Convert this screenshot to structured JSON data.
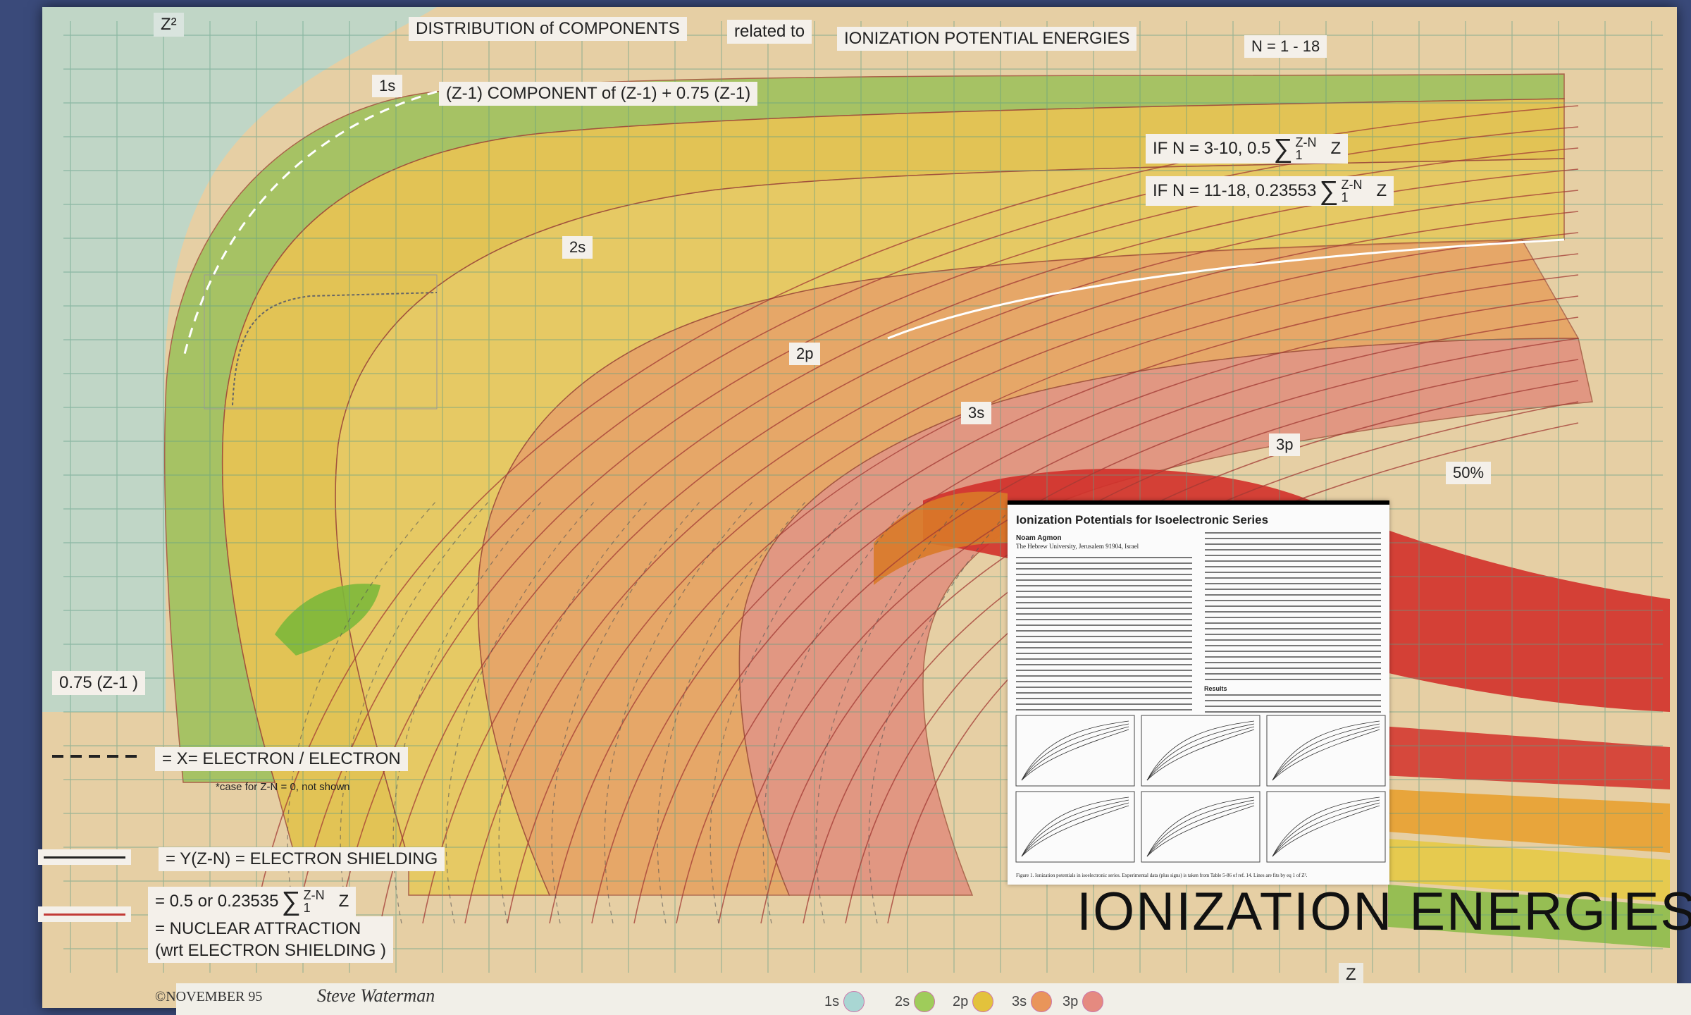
{
  "title": {
    "line": "DISTRIBUTION of COMPONENTS",
    "related": "related to",
    "topic": "IONIZATION POTENTIAL ENERGIES",
    "range": "N = 1 - 18"
  },
  "axes": {
    "y_label": "Z²",
    "x_label": "Z"
  },
  "component_label": "(Z-1)  COMPONENT of  (Z-1)  +  0.75 (Z-1)",
  "conditions": [
    {
      "prefix": "IF N = 3-10, 0.5",
      "upper": "Z-N",
      "lower": "1",
      "suffix": "Z"
    },
    {
      "prefix": "IF N = 11-18, 0.23553",
      "upper": "Z-N",
      "lower": "1",
      "suffix": "Z"
    }
  ],
  "orbital_labels": {
    "s1": "1s",
    "s2": "2s",
    "p2": "2p",
    "s3": "3s",
    "p3": "3p",
    "pct": "50%"
  },
  "left_label": "0.75 (Z-1 )",
  "legend": {
    "x_def": "= X= ELECTRON / ELECTRON",
    "x_note": "*case for Z-N = 0, not shown",
    "y_def": "= Y(Z-N) = ELECTRON SHIELDING",
    "shield_prefix": "= 0.5 or 0.23535",
    "shield_upper": "Z-N",
    "shield_lower": "1",
    "shield_suffix": "Z",
    "nuclear_1": "= NUCLEAR ATTRACTION",
    "nuclear_2": "(wrt ELECTRON SHIELDING )"
  },
  "paper": {
    "title": "Ionization Potentials for Isoelectronic Series",
    "author": "Noam Agmon",
    "affiliation": "The Hebrew University, Jerusalem 91904, Israel",
    "results_head": "Results",
    "caption": "Figure 1. Ionization potentials in isoelectronic series. Experimental data (plus signs) is taken from Table 5-86 of ref. 14. Lines are fits by eq 1 of Z²."
  },
  "big_title": "IONIZATION     ENERGIES",
  "copyright": "©NOVEMBER 95",
  "signature": "Steve Waterman",
  "footer": [
    {
      "label": "1s",
      "color": "#a9d6d3"
    },
    {
      "label": "2s",
      "color": "#9fcc5a"
    },
    {
      "label": "2p",
      "color": "#e3c23c"
    },
    {
      "label": "3s",
      "color": "#e9955a"
    },
    {
      "label": "3p",
      "color": "#e58a80"
    }
  ],
  "colors": {
    "board": "#e6cfa4",
    "grid": "#5f9e86",
    "band_1s": "#b9d7cc",
    "band_2s": "#9cc05a",
    "band_2p": "#e2c148",
    "band_3s": "#e79a55",
    "band_3p": "#e08a7a",
    "band_red": "#d2302a"
  }
}
